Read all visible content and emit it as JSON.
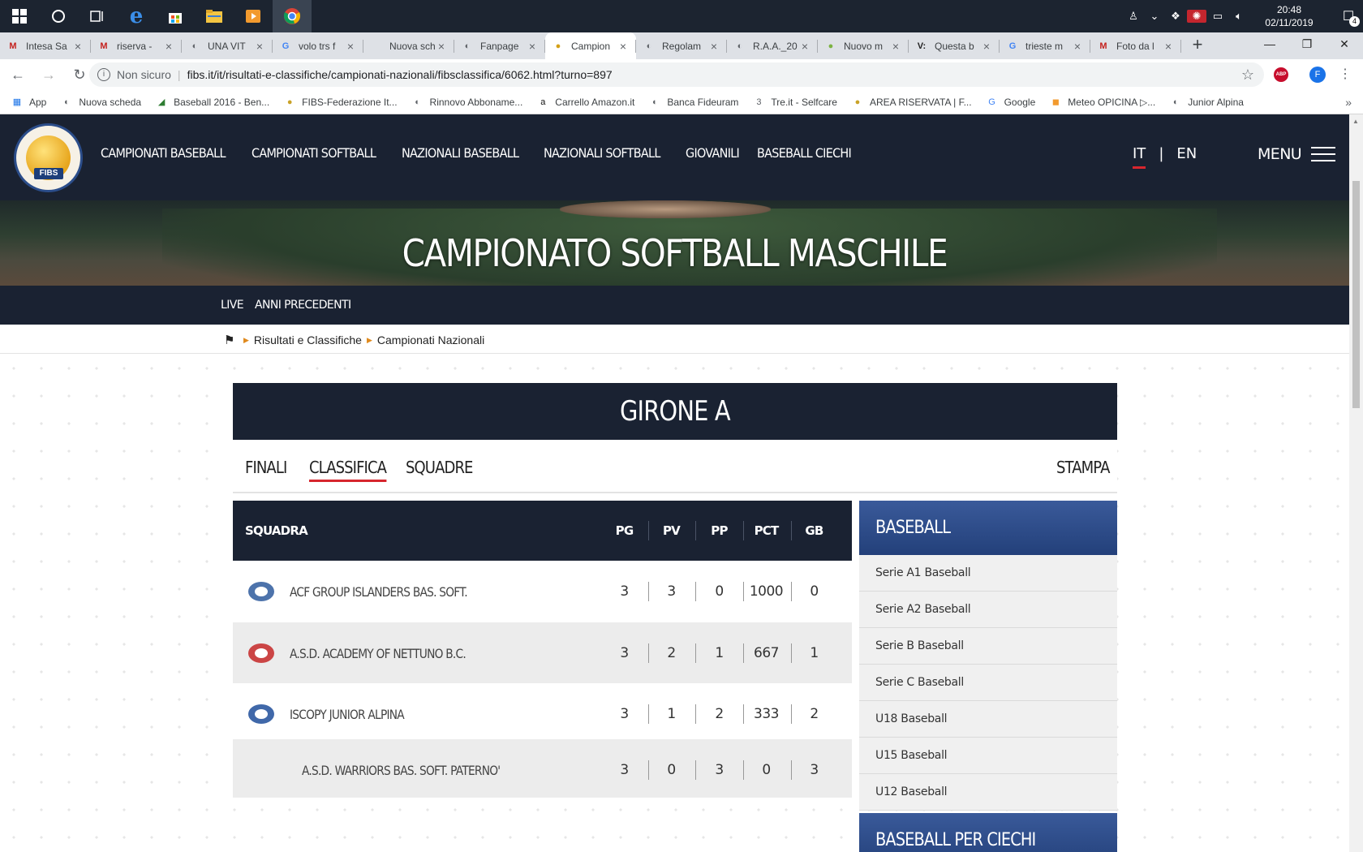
{
  "taskbar": {
    "clock_time": "20:48",
    "clock_date": "02/11/2019",
    "notification_count": "4"
  },
  "browser": {
    "tabs": [
      {
        "title": "Intesa Sa",
        "favicon": "M"
      },
      {
        "title": "riserva -",
        "favicon": "M"
      },
      {
        "title": "UNA VIT",
        "favicon": "◐"
      },
      {
        "title": "volo trs f",
        "favicon": "G"
      },
      {
        "title": "Nuova sched",
        "favicon": ""
      },
      {
        "title": "Fanpage",
        "favicon": "◐"
      },
      {
        "title": "Campion",
        "favicon": "●"
      },
      {
        "title": "Regolam",
        "favicon": "◐"
      },
      {
        "title": "R.A.A._20",
        "favicon": "◐"
      },
      {
        "title": "Nuovo m",
        "favicon": "●"
      },
      {
        "title": "Questa b",
        "favicon": "V:"
      },
      {
        "title": "trieste m",
        "favicon": "G"
      },
      {
        "title": "Foto da l",
        "favicon": "M"
      }
    ],
    "security_label": "Non sicuro",
    "url": "fibs.it/it/risultati-e-classifiche/campionati-nazionali/fibsclassifica/6062.html?turno=897",
    "bookmarks": [
      {
        "label": "App",
        "icon": "▦"
      },
      {
        "label": "Nuova scheda",
        "icon": "◐"
      },
      {
        "label": "Baseball 2016 - Ben...",
        "icon": "◢"
      },
      {
        "label": "FIBS-Federazione It...",
        "icon": "●"
      },
      {
        "label": "Rinnovo Abboname...",
        "icon": "◐"
      },
      {
        "label": "Carrello Amazon.it",
        "icon": "a"
      },
      {
        "label": "Banca Fideuram",
        "icon": "◐"
      },
      {
        "label": "Tre.it - Selfcare",
        "icon": "3"
      },
      {
        "label": "AREA RISERVATA | F...",
        "icon": "●"
      },
      {
        "label": "Google",
        "icon": "G"
      },
      {
        "label": "Meteo OPICINA ▷...",
        "icon": "◼"
      },
      {
        "label": "Junior Alpina",
        "icon": "◐"
      }
    ]
  },
  "site": {
    "logo_text": "FIBS",
    "main_nav": [
      "CAMPIONATI BASEBALL",
      "CAMPIONATI SOFTBALL",
      "NAZIONALI BASEBALL",
      "NAZIONALI SOFTBALL",
      "GIOVANILI",
      "BASEBALL CIECHI"
    ],
    "lang_it": "IT",
    "lang_separator": "|",
    "lang_en": "EN",
    "menu_label": "MENU",
    "hero_title": "CAMPIONATO SOFTBALL MASCHILE",
    "sub_nav": [
      "LIVE",
      "ANNI PRECEDENTI"
    ],
    "breadcrumb": [
      "Risultati e Classifiche",
      "Campionati Nazionali"
    ],
    "group_title": "GIRONE A",
    "page_tabs": [
      "FINALI",
      "CLASSIFICA",
      "SQUADRE"
    ],
    "print_label": "STAMPA"
  },
  "standings": {
    "headers": {
      "team": "SQUADRA",
      "pg": "PG",
      "pv": "PV",
      "pp": "PP",
      "pct": "PCT",
      "gb": "GB"
    },
    "rows": [
      {
        "team": "ACF GROUP ISLANDERS BAS. SOFT.",
        "pg": "3",
        "pv": "3",
        "pp": "0",
        "pct": "1000",
        "gb": "0"
      },
      {
        "team": "A.S.D. ACADEMY OF NETTUNO B.C.",
        "pg": "3",
        "pv": "2",
        "pp": "1",
        "pct": "667",
        "gb": "1"
      },
      {
        "team": "ISCOPY JUNIOR ALPINA",
        "pg": "3",
        "pv": "1",
        "pp": "2",
        "pct": "333",
        "gb": "2"
      },
      {
        "team": "A.S.D. WARRIORS BAS. SOFT. PATERNO'",
        "pg": "3",
        "pv": "0",
        "pp": "3",
        "pct": "0",
        "gb": "3"
      }
    ]
  },
  "sidebar": {
    "heading": "BASEBALL",
    "items": [
      "Serie A1 Baseball",
      "Serie A2 Baseball",
      "Serie B Baseball",
      "Serie C Baseball",
      "U18 Baseball",
      "U15 Baseball",
      "U12 Baseball"
    ],
    "heading2": "BASEBALL PER CIECHI"
  }
}
